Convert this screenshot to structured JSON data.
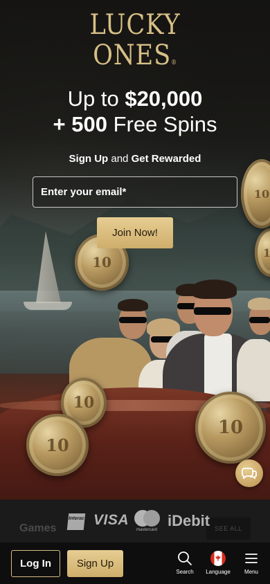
{
  "brand": {
    "line1": "LUCKY",
    "line2": "ONES",
    "registered": "®"
  },
  "hero": {
    "headline_prefix": "Up to",
    "headline_amount": "$20,000",
    "headline_spins_count": "+ 500",
    "headline_spins_label": "Free Spins",
    "sub_strong1": "Sign Up",
    "sub_mid": "and",
    "sub_strong2": "Get Rewarded",
    "email_placeholder": "Enter your email*",
    "join_label": "Join Now!",
    "coin_mark": "10"
  },
  "payments": {
    "games_label": "Games",
    "see_all_label": "SEE ALL",
    "interac_label": "Interac",
    "visa_label": "VISA",
    "mastercard_label": "mastercard",
    "idebit_label": "iDebit"
  },
  "nav": {
    "login_label": "Log In",
    "signup_label": "Sign Up",
    "search_label": "Search",
    "language_label": "Language",
    "menu_label": "Menu"
  },
  "colors": {
    "gold": "#d7bf86",
    "button_gold": "#e6cd92",
    "background": "#0e0e0e",
    "flag_red": "#d52b1e"
  },
  "icons": [
    "search-icon",
    "canada-flag-icon",
    "hamburger-menu-icon",
    "chat-icon"
  ]
}
